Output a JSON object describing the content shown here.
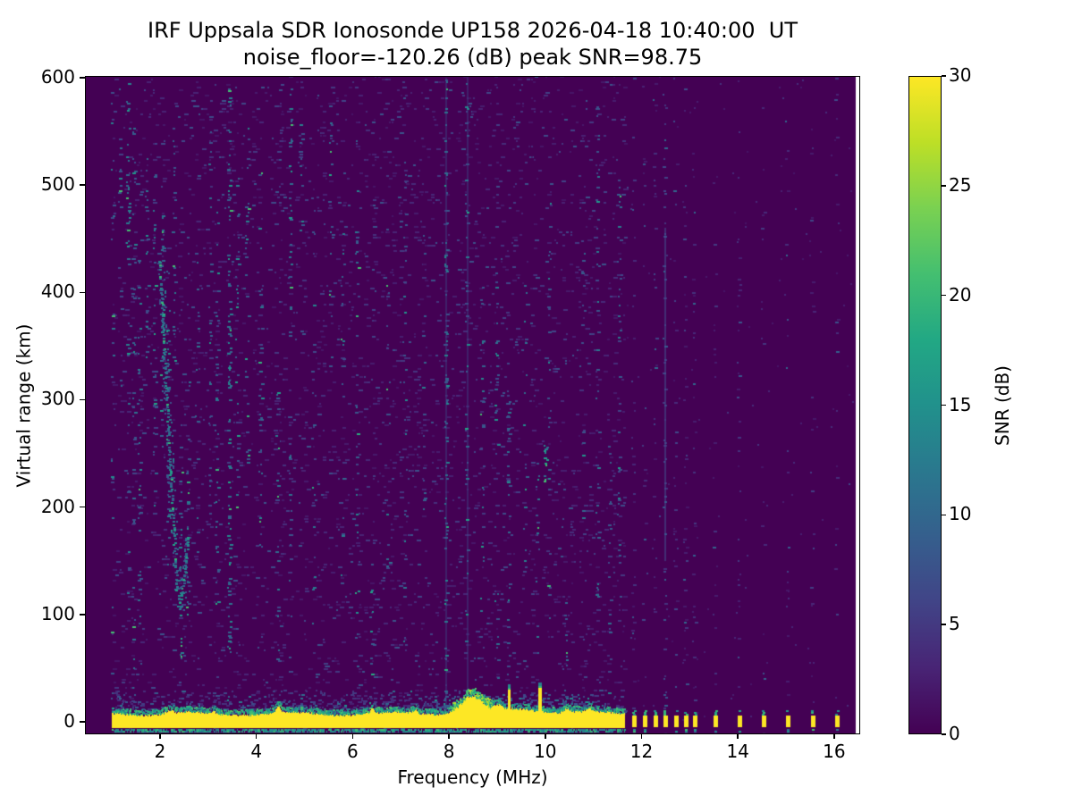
{
  "title": {
    "line1": "IRF Uppsala SDR Ionosonde UP158 2026-04-18 10:40:00  UT",
    "line2": "noise_floor=-120.26 (dB) peak SNR=98.75"
  },
  "chart_data": {
    "type": "heatmap",
    "title": "IRF Uppsala SDR Ionosonde UP158 2026-04-18 10:40:00  UT",
    "subtitle": "noise_floor=-120.26 (dB) peak SNR=98.75",
    "xlabel": "Frequency (MHz)",
    "ylabel": "Virtual range (km)",
    "xlim": [
      0.44,
      16.54
    ],
    "ylim": [
      -11.7,
      601.5
    ],
    "xticks": [
      2,
      4,
      6,
      8,
      10,
      12,
      14,
      16
    ],
    "yticks": [
      0,
      100,
      200,
      300,
      400,
      500,
      600
    ],
    "grid": false,
    "noise_floor_db": -120.26,
    "peak_snr_db": 98.75,
    "colorbar": {
      "label": "SNR (dB)",
      "min": 0,
      "max": 30,
      "ticks": [
        0,
        5,
        10,
        15,
        20,
        25,
        30
      ],
      "colormap": "viridis",
      "stops": [
        [
          0.0,
          "#440154"
        ],
        [
          0.1,
          "#482475"
        ],
        [
          0.2,
          "#414487"
        ],
        [
          0.3,
          "#355f8d"
        ],
        [
          0.4,
          "#2a788e"
        ],
        [
          0.5,
          "#21918c"
        ],
        [
          0.6,
          "#22a884"
        ],
        [
          0.7,
          "#44bf70"
        ],
        [
          0.8,
          "#7ad151"
        ],
        [
          0.9,
          "#bddf26"
        ],
        [
          1.0,
          "#fde725"
        ]
      ]
    },
    "content": {
      "seed": 42,
      "freq_start": 1.0,
      "freq_continuous_end": 11.63,
      "data_end": 16.45,
      "band": {
        "base_top_km": 6.5,
        "bottom_km": -5.5,
        "note": "saturated ground/0-km echo band, SNR ~30 dB"
      },
      "nubs": [
        [
          8.45,
          15,
          0.3
        ],
        [
          9.0,
          4,
          0.1
        ],
        [
          4.45,
          5,
          0.07
        ],
        [
          6.4,
          4,
          0.06
        ],
        [
          3.1,
          3,
          0.05
        ],
        [
          7.3,
          3,
          0.05
        ],
        [
          10.45,
          4,
          0.07
        ],
        [
          10.9,
          3,
          0.06
        ],
        [
          2.2,
          3,
          0.08
        ],
        [
          9.5,
          2.5,
          0.5
        ]
      ],
      "spikes": [
        {
          "f": 9.25,
          "top": 30,
          "w": 3
        },
        {
          "f": 9.9,
          "top": 32,
          "w": 4
        }
      ],
      "bars": [
        {
          "f": 11.85
        },
        {
          "f": 12.06
        },
        {
          "f": 12.28
        },
        {
          "f": 12.5,
          "hot": 1
        },
        {
          "f": 12.71
        },
        {
          "f": 12.92
        },
        {
          "f": 13.1
        },
        {
          "f": 13.53
        },
        {
          "f": 14.03
        },
        {
          "f": 14.53
        },
        {
          "f": 15.04
        },
        {
          "f": 15.55
        },
        {
          "f": 16.06
        }
      ],
      "stripes": [
        [
          1.02,
          -8,
          600,
          0.22
        ],
        [
          1.18,
          300,
          600,
          0.25
        ],
        [
          1.35,
          430,
          595,
          0.75
        ],
        [
          1.35,
          100,
          430,
          0.3
        ],
        [
          1.47,
          0,
          560,
          0.3
        ],
        [
          1.58,
          80,
          430,
          0.5
        ],
        [
          1.74,
          340,
          600,
          0.35
        ],
        [
          1.9,
          200,
          510,
          0.4
        ],
        [
          2.05,
          250,
          480,
          0.55
        ],
        [
          2.18,
          140,
          420,
          0.55
        ],
        [
          2.3,
          330,
          560,
          0.4
        ],
        [
          2.45,
          60,
          260,
          0.5
        ],
        [
          2.6,
          100,
          330,
          0.4
        ],
        [
          2.78,
          140,
          460,
          0.32
        ],
        [
          3.05,
          180,
          560,
          0.32
        ],
        [
          3.2,
          90,
          500,
          0.38
        ],
        [
          3.45,
          60,
          600,
          0.7
        ],
        [
          3.62,
          200,
          510,
          0.42
        ],
        [
          3.82,
          240,
          570,
          0.35
        ],
        [
          4.1,
          140,
          530,
          0.32
        ],
        [
          4.45,
          40,
          310,
          0.28
        ],
        [
          4.72,
          370,
          590,
          0.55
        ],
        [
          4.72,
          40,
          370,
          0.3
        ],
        [
          4.95,
          440,
          570,
          0.45
        ],
        [
          5.2,
          90,
          510,
          0.22
        ],
        [
          5.55,
          290,
          560,
          0.26
        ],
        [
          5.8,
          90,
          460,
          0.26
        ],
        [
          6.1,
          40,
          560,
          0.3
        ],
        [
          6.4,
          10,
          130,
          0.4
        ],
        [
          6.75,
          140,
          410,
          0.22
        ],
        [
          7.1,
          40,
          510,
          0.26
        ],
        [
          7.5,
          190,
          460,
          0.22
        ],
        [
          7.95,
          -5,
          600,
          0.5,
          1
        ],
        [
          8.38,
          0,
          600,
          0.35,
          1
        ],
        [
          8.7,
          90,
          410,
          0.26
        ],
        [
          9.0,
          10,
          130,
          0.5
        ],
        [
          9.0,
          240,
          430,
          0.35
        ],
        [
          9.25,
          30,
          310,
          0.3
        ],
        [
          9.6,
          140,
          410,
          0.26
        ],
        [
          9.85,
          40,
          260,
          0.26
        ],
        [
          10.02,
          222,
          258,
          0.85
        ],
        [
          10.1,
          90,
          510,
          0.22
        ],
        [
          10.45,
          5,
          115,
          0.45
        ],
        [
          10.8,
          140,
          460,
          0.22
        ],
        [
          11.1,
          90,
          580,
          0.35
        ],
        [
          11.35,
          40,
          310,
          0.26
        ],
        [
          11.55,
          140,
          510,
          0.26
        ]
      ],
      "trace": [
        [
          2.0,
          430
        ],
        [
          2.07,
          365
        ],
        [
          2.14,
          300
        ],
        [
          2.21,
          240
        ],
        [
          2.28,
          180
        ],
        [
          2.35,
          125
        ],
        [
          2.42,
          106
        ],
        [
          2.5,
          132
        ],
        [
          2.58,
          172
        ]
      ]
    }
  }
}
